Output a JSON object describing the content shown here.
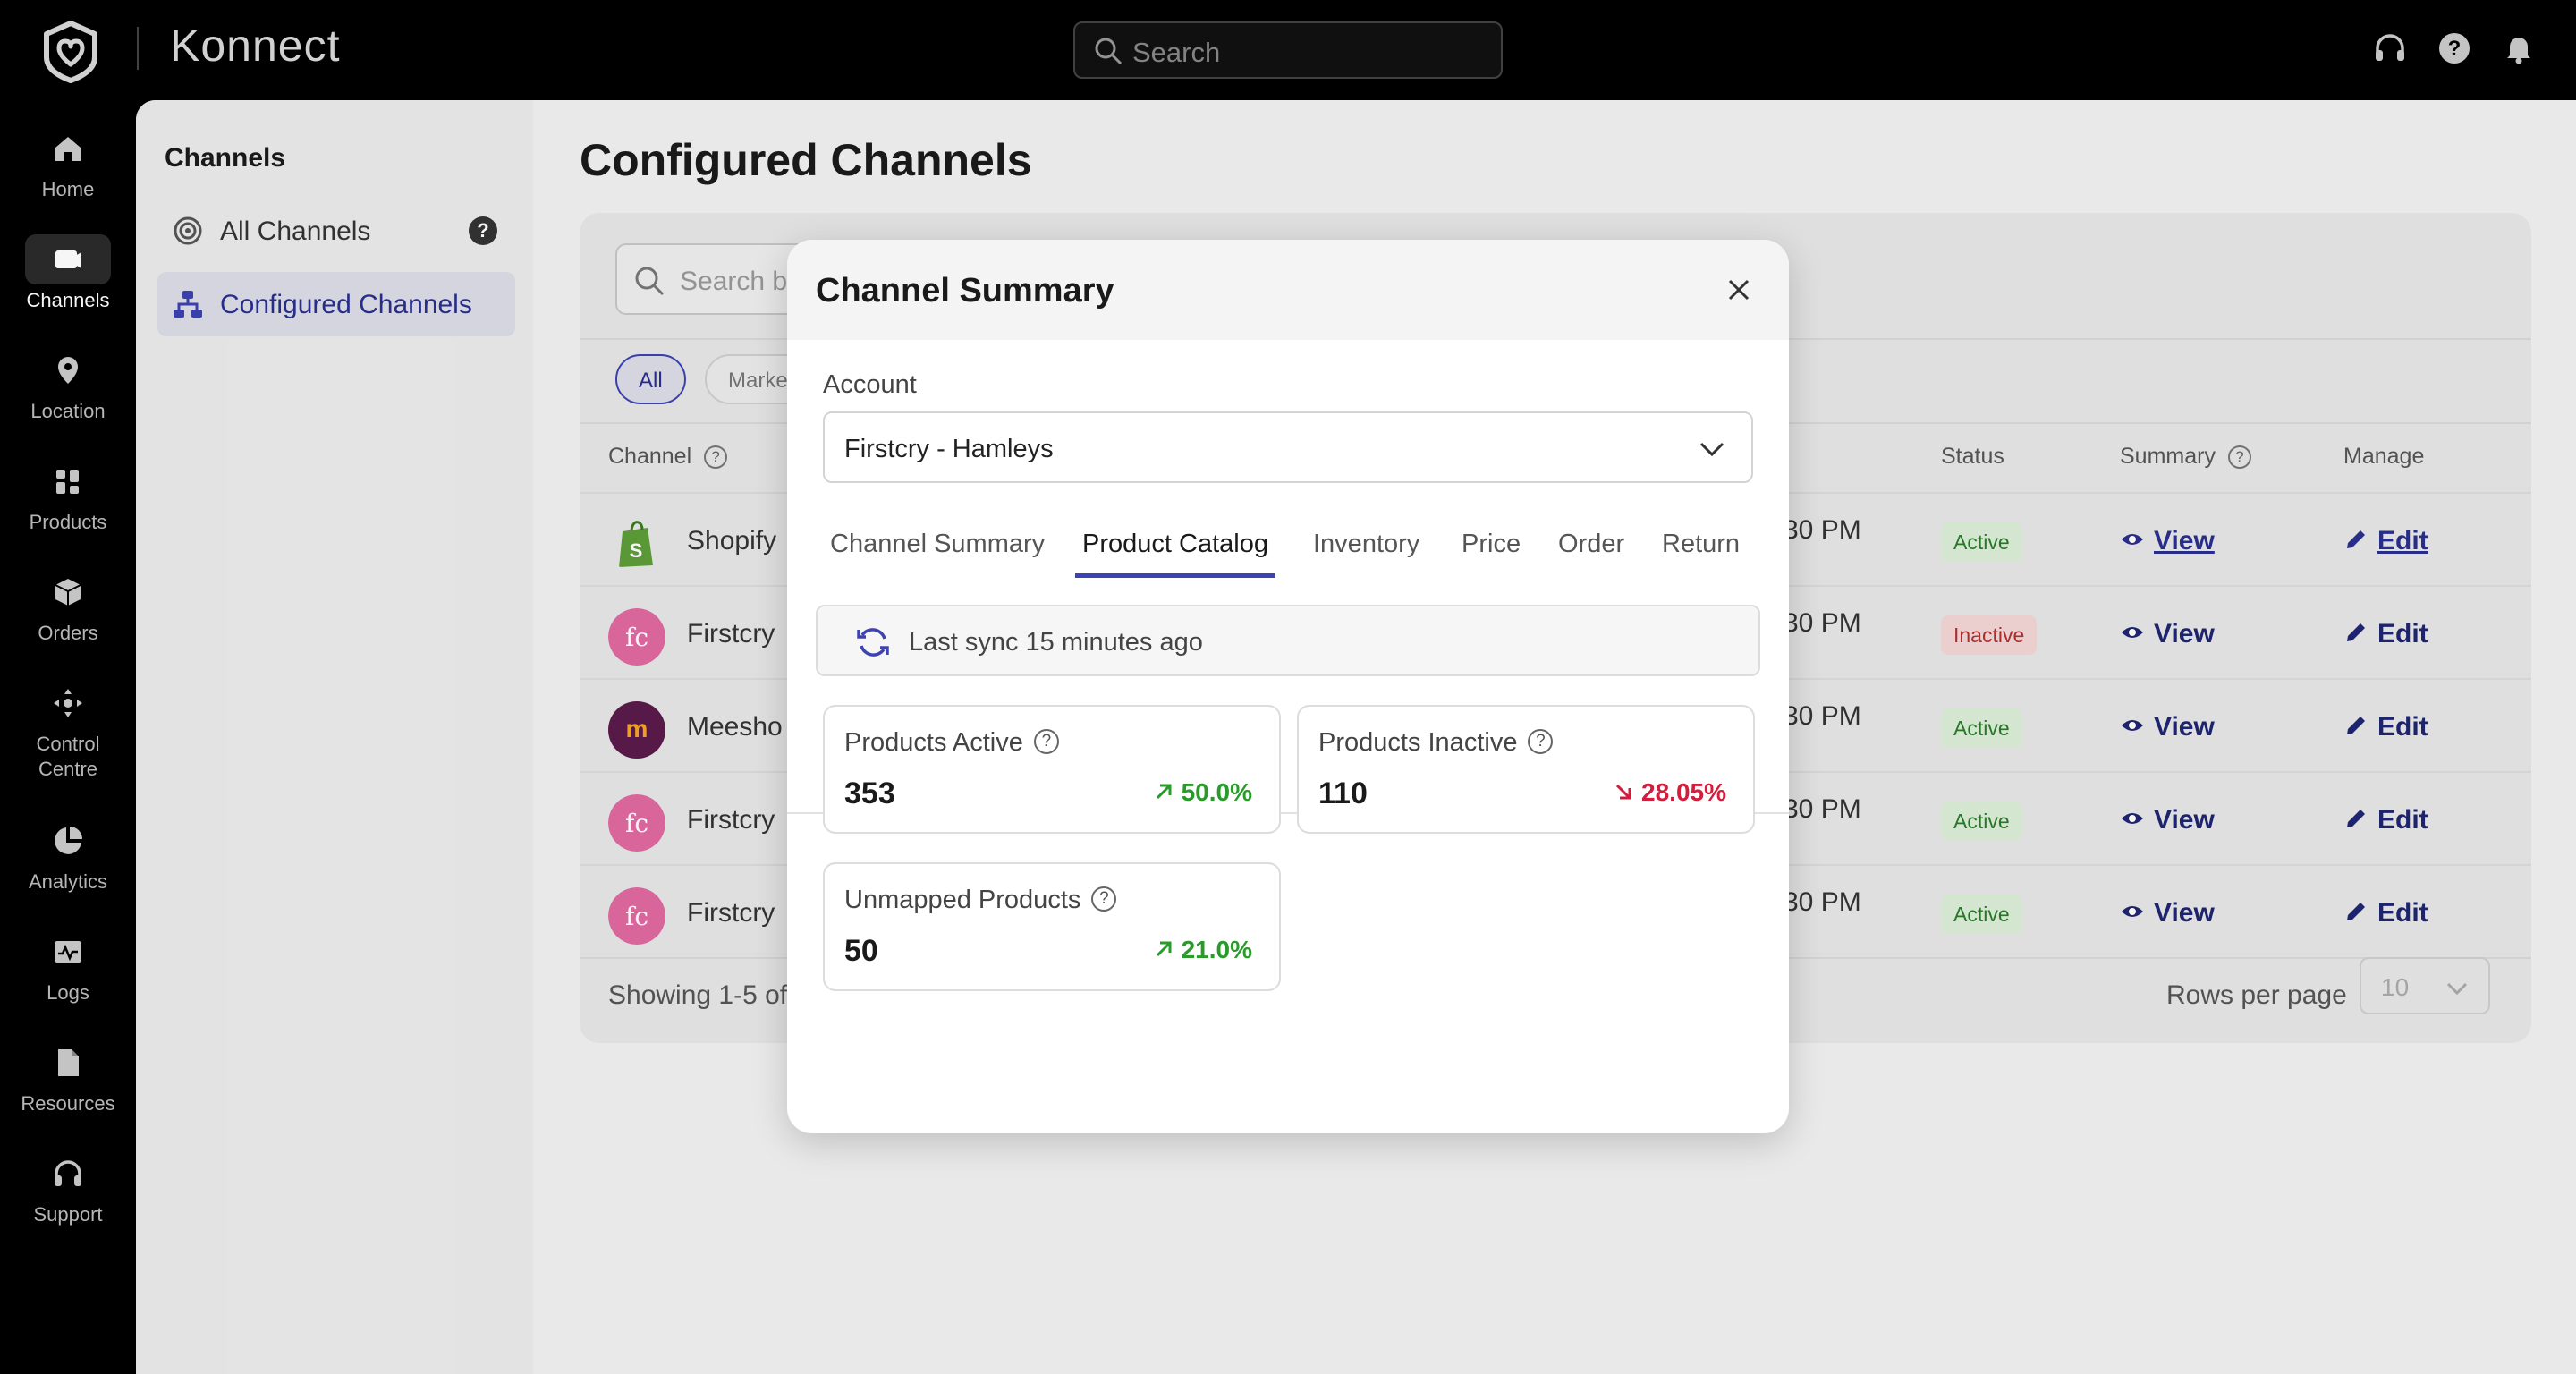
{
  "app": {
    "name": "Konnect",
    "search_placeholder": "Search"
  },
  "rail": [
    {
      "label": "Home",
      "icon": "home-icon"
    },
    {
      "label": "Channels",
      "icon": "channels-icon",
      "active": true
    },
    {
      "label": "Location",
      "icon": "location-icon"
    },
    {
      "label": "Products",
      "icon": "products-icon"
    },
    {
      "label": "Orders",
      "icon": "orders-icon"
    },
    {
      "label": "Control\nCentre",
      "icon": "control-centre-icon"
    },
    {
      "label": "Analytics",
      "icon": "analytics-icon"
    },
    {
      "label": "Logs",
      "icon": "logs-icon"
    },
    {
      "label": "Resources",
      "icon": "resources-icon"
    },
    {
      "label": "Support",
      "icon": "support-icon"
    }
  ],
  "subnav": {
    "title": "Channels",
    "items": [
      {
        "label": "All Channels",
        "help": "?"
      },
      {
        "label": "Configured Channels",
        "active": true
      }
    ]
  },
  "page": {
    "title": "Configured Channels",
    "search_placeholder": "Search b",
    "chips": [
      "All",
      "Marke"
    ],
    "columns": {
      "channel": "Channel",
      "status": "Status",
      "summary": "Summary",
      "manage": "Manage"
    },
    "rows": [
      {
        "name": "Shopify",
        "time": "30 PM",
        "status": "Active",
        "view": "View",
        "edit": "Edit"
      },
      {
        "name": "Firstcry",
        "time": "30 PM",
        "status": "Inactive",
        "view": "View",
        "edit": "Edit"
      },
      {
        "name": "Meesho",
        "time": "30 PM",
        "status": "Active",
        "view": "View",
        "edit": "Edit"
      },
      {
        "name": "Firstcry",
        "time": "30 PM",
        "status": "Active",
        "view": "View",
        "edit": "Edit"
      },
      {
        "name": "Firstcry",
        "time": "30 PM",
        "status": "Active",
        "view": "View",
        "edit": "Edit"
      }
    ],
    "footer": {
      "showing": "Showing 1-5 of",
      "rows_per_page": "Rows per page",
      "rows_value": "10"
    }
  },
  "modal": {
    "title": "Channel Summary",
    "account_label": "Account",
    "account_value": "Firstcry - Hamleys",
    "tabs": [
      "Channel Summary",
      "Product Catalog",
      "Inventory",
      "Price",
      "Order",
      "Return"
    ],
    "selected_tab": "Product Catalog",
    "sync_text": "Last sync 15 minutes ago",
    "stats": [
      {
        "label": "Products Active",
        "value": "353",
        "change": "50.0%",
        "direction": "up"
      },
      {
        "label": "Products Inactive",
        "value": "110",
        "change": "28.05%",
        "direction": "down"
      },
      {
        "label": "Unmapped Products",
        "value": "50",
        "change": "21.0%",
        "direction": "up"
      }
    ]
  },
  "colors": {
    "accent": "#3d43b0",
    "up": "#2a9a2a",
    "down": "#d01e3c"
  }
}
